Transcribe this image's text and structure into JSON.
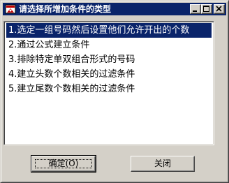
{
  "window": {
    "title": "请选择所增加条件的类型"
  },
  "list": {
    "items": [
      "1.选定一组号码然后设置他们允许开出的个数",
      "2.通过公式建立条件",
      "3.排除特定单双组合形式的号码",
      "4.建立头数个数相关的过滤条件",
      "5.建立尾数个数相关的过滤条件"
    ],
    "selected_index": 0
  },
  "buttons": {
    "ok_label": "确定(O)",
    "close_label": "关闭"
  },
  "icons": {
    "app": "app-icon",
    "minimize": "minimize-icon",
    "maximize": "maximize-icon",
    "close": "close-icon"
  },
  "colors": {
    "titlebar": "#0a246a",
    "selection": "#0a246a",
    "face": "#d4d0c8"
  }
}
